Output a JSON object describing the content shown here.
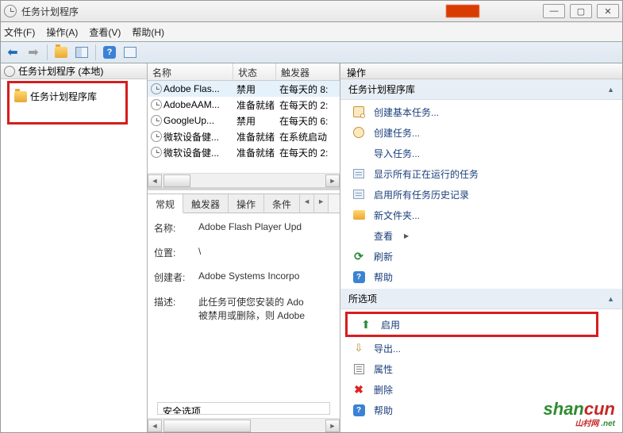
{
  "window": {
    "title": "任务计划程序",
    "red_label": ""
  },
  "winbtns": {
    "min": "—",
    "max": "▢",
    "close": "✕"
  },
  "menu": {
    "file": "文件(F)",
    "action": "操作(A)",
    "view": "查看(V)",
    "help": "帮助(H)"
  },
  "tree": {
    "root": "任务计划程序 (本地)",
    "child": "任务计划程序库"
  },
  "task_columns": {
    "name": "名称",
    "status": "状态",
    "trigger": "触发器"
  },
  "tasks": [
    {
      "name": "Adobe Flas...",
      "status": "禁用",
      "trigger": "在每天的 8:"
    },
    {
      "name": "AdobeAAM...",
      "status": "准备就绪",
      "trigger": "在每天的 2:"
    },
    {
      "name": "GoogleUp...",
      "status": "禁用",
      "trigger": "在每天的 6:"
    },
    {
      "name": "微软设备健...",
      "status": "准备就绪",
      "trigger": "在系统启动"
    },
    {
      "name": "微软设备健...",
      "status": "准备就绪",
      "trigger": "在每天的 2:"
    }
  ],
  "detail_tabs": {
    "general": "常规",
    "triggers": "触发器",
    "actions": "操作",
    "conditions": "条件"
  },
  "detail": {
    "name_lbl": "名称:",
    "name_val": "Adobe Flash Player Upd",
    "loc_lbl": "位置:",
    "loc_val": "\\",
    "author_lbl": "创建者:",
    "author_val": "Adobe Systems Incorpo",
    "desc_lbl": "描述:",
    "desc_val": "此任务可使您安装的 Ado\n被禁用或删除，则 Adobe",
    "safe": "安全选项"
  },
  "actions_panel": {
    "header": "操作",
    "section1": "任务计划程序库",
    "items1": {
      "basic": "创建基本任务...",
      "create": "创建任务...",
      "import": "导入任务...",
      "running": "显示所有正在运行的任务",
      "history": "启用所有任务历史记录",
      "newfolder": "新文件夹...",
      "view": "查看",
      "refresh": "刷新",
      "help": "帮助"
    },
    "section2": "所选项",
    "items2": {
      "enable": "启用",
      "export": "导出...",
      "props": "属性",
      "delete": "删除",
      "help": "帮助"
    }
  },
  "watermark": {
    "a": "shan",
    "b": "cun",
    "s1": "山村网",
    "s2": ".net"
  }
}
